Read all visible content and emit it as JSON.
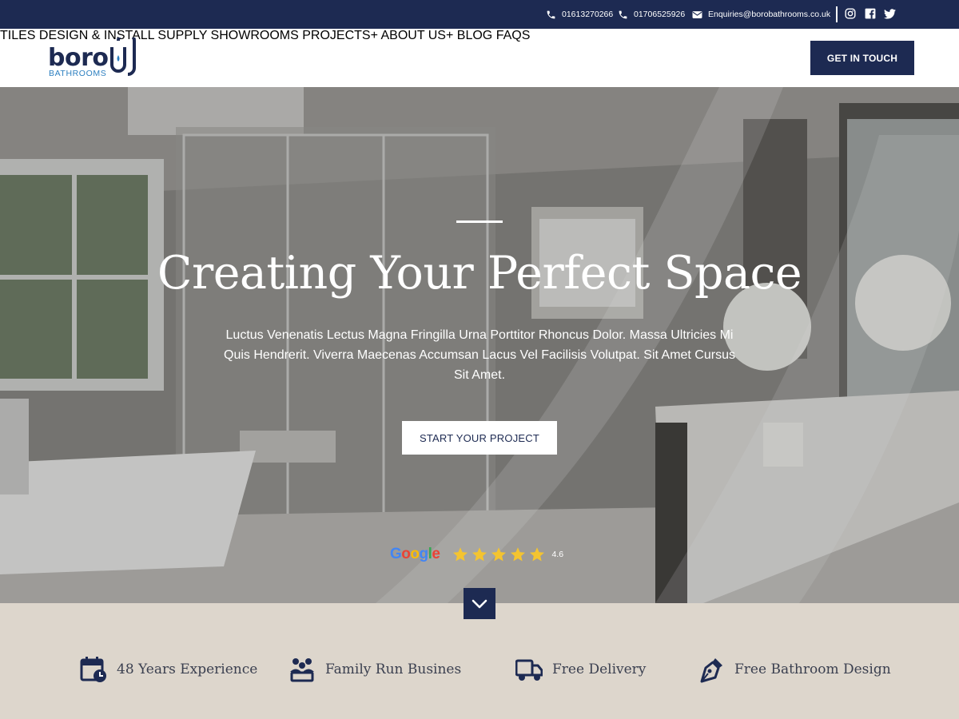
{
  "topbar": {
    "phone1": "01613270266",
    "phone2": "01706525926",
    "email": "Enquiries@borobathrooms.co.uk",
    "social": [
      "instagram-icon",
      "facebook-icon",
      "twitter-icon"
    ]
  },
  "logo": {
    "word": "boro",
    "sub": "BATHROOMS"
  },
  "nav": {
    "items": [
      "TILES",
      "DESIGN & INSTALL",
      "SUPPLY",
      "SHOWROOMS",
      "PROJECTS+",
      "ABOUT US+",
      "BLOG",
      "FAQS"
    ],
    "cta": "GET IN TOUCH"
  },
  "hero": {
    "title": "Creating Your Perfect Space",
    "lead": "Luctus Venenatis Lectus Magna Fringilla Urna Porttitor Rhoncus Dolor. Massa Ultricies Mi Quis Hendrerit. Viverra Maecenas Accumsan Lacus Vel Facilisis Volutpat. Sit Amet Cursus Sit Amet.",
    "button": "START YOUR PROJECT",
    "rating": {
      "provider": "Google",
      "stars": 5,
      "score": "4.6"
    }
  },
  "features": [
    {
      "icon": "calendar-clock-icon",
      "label": "48 Years Experience"
    },
    {
      "icon": "family-icon",
      "label": "Family Run Busines"
    },
    {
      "icon": "delivery-truck-icon",
      "label": "Free Delivery"
    },
    {
      "icon": "design-pen-icon",
      "label": "Free Bathroom Design"
    }
  ],
  "colors": {
    "navy": "#1d2a52",
    "accent": "#2c7fc0",
    "beige": "#ddd6cc",
    "star": "#f4c430"
  }
}
